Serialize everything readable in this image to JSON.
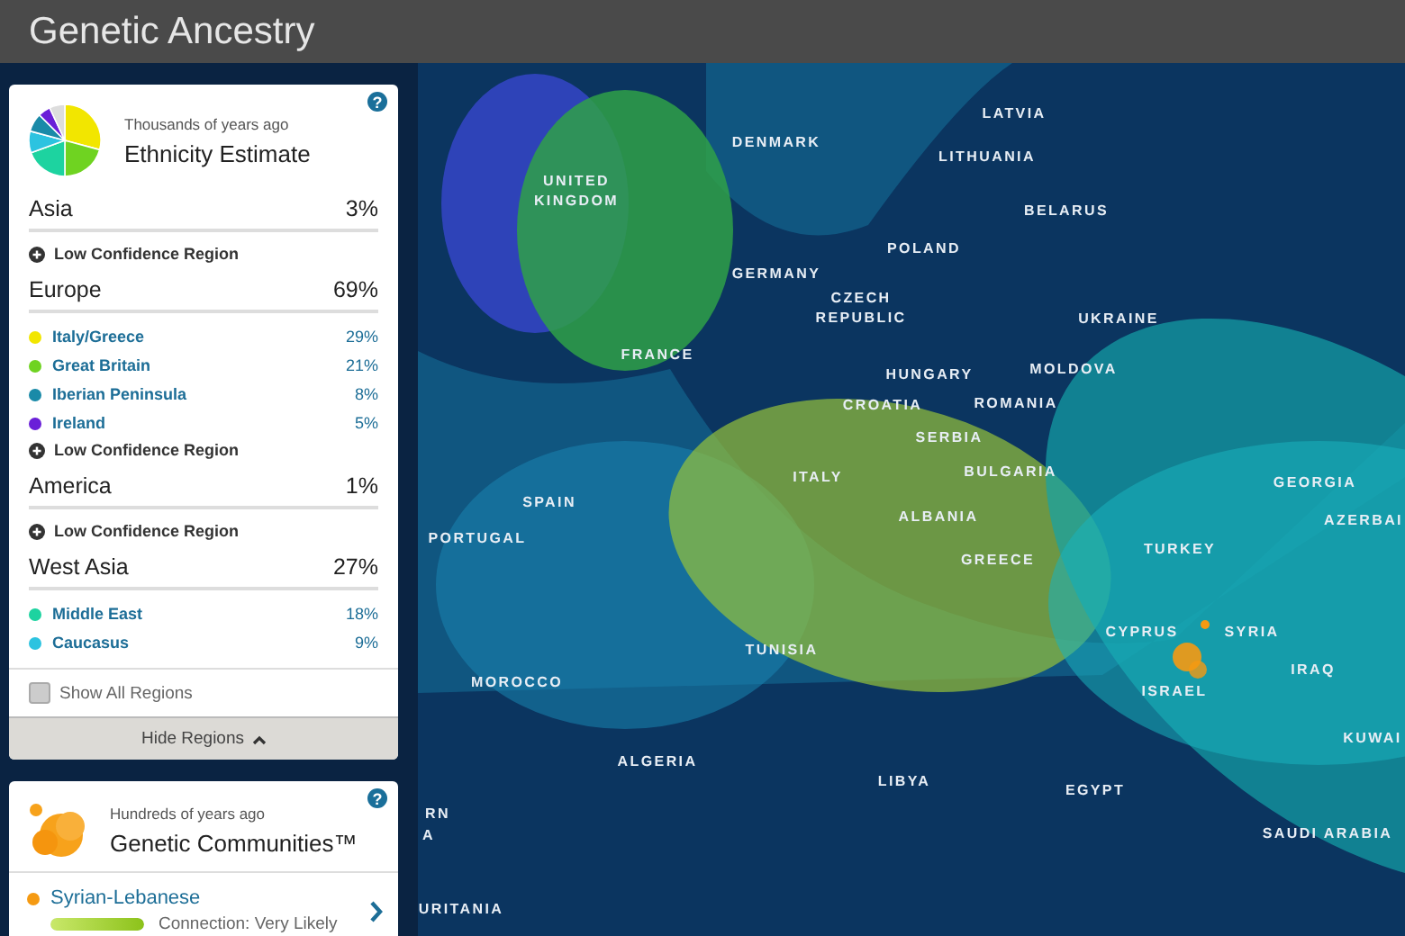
{
  "header": {
    "title": "Genetic Ancestry"
  },
  "estimate": {
    "help": "?",
    "subtitle": "Thousands of years ago",
    "title": "Ethnicity Estimate",
    "groups": [
      {
        "name": "Asia",
        "percent": "3%",
        "low_confidence": "Low Confidence Region"
      },
      {
        "name": "Europe",
        "percent": "69%",
        "low_confidence": "Low Confidence Region",
        "subregions": [
          {
            "name": "Italy/Greece",
            "percent": "29%",
            "color": "#f2e600"
          },
          {
            "name": "Great Britain",
            "percent": "21%",
            "color": "#6fd321"
          },
          {
            "name": "Iberian Peninsula",
            "percent": "8%",
            "color": "#1a8aa8"
          },
          {
            "name": "Ireland",
            "percent": "5%",
            "color": "#6a1fd8"
          }
        ]
      },
      {
        "name": "America",
        "percent": "1%",
        "low_confidence": "Low Confidence Region"
      },
      {
        "name": "West Asia",
        "percent": "27%",
        "subregions": [
          {
            "name": "Middle East",
            "percent": "18%",
            "color": "#1dd3a0"
          },
          {
            "name": "Caucasus",
            "percent": "9%",
            "color": "#2cc3e0"
          }
        ]
      }
    ],
    "show_all": {
      "label": "Show All Regions",
      "checked": false
    },
    "hide_button": "Hide Regions"
  },
  "communities": {
    "help": "?",
    "subtitle": "Hundreds of years ago",
    "title": "Genetic Communities™",
    "items": [
      {
        "name": "Syrian-Lebanese",
        "color": "#f59a12",
        "level": 1,
        "connection": "Connection: Very Likely"
      }
    ]
  },
  "map": {
    "labels": [
      "LATVIA",
      "DENMARK",
      "LITHUANIA",
      "UNITED KINGDOM",
      "BELARUS",
      "POLAND",
      "GERMANY",
      "CZECH REPUBLIC",
      "UKRAINE",
      "FRANCE",
      "HUNGARY",
      "MOLDOVA",
      "ROMANIA",
      "CROATIA",
      "SERBIA",
      "BULGARIA",
      "GEORGIA",
      "ITALY",
      "SPAIN",
      "ALBANIA",
      "AZERBAI",
      "PORTUGAL",
      "TURKEY",
      "GREECE",
      "CYPRUS",
      "SYRIA",
      "TUNISIA",
      "IRAQ",
      "MOROCCO",
      "ISRAEL",
      "KUWAI",
      "ALGERIA",
      "LIBYA",
      "EGYPT",
      "RN",
      "A",
      "SAUDI ARABIA",
      "URITANIA"
    ]
  }
}
